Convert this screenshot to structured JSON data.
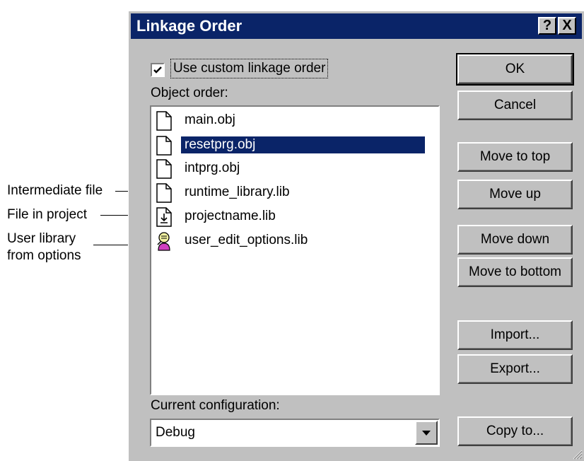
{
  "annotations": {
    "intermediate": "Intermediate file",
    "project": "File in project",
    "user_lib_1": "User library",
    "user_lib_2": "from options"
  },
  "dialog": {
    "title": "Linkage Order",
    "help_label": "?",
    "close_label": "X",
    "custom_order_label": "Use custom linkage order",
    "custom_order_checked": true,
    "object_order_label": "Object order:",
    "current_config_label": "Current configuration:",
    "current_config_value": "Debug"
  },
  "objects": [
    {
      "name": "main.obj",
      "icon": "file-icon"
    },
    {
      "name": "resetprg.obj",
      "icon": "file-icon",
      "selected": true
    },
    {
      "name": "intprg.obj",
      "icon": "file-icon"
    },
    {
      "name": "runtime_library.lib",
      "icon": "file-icon"
    },
    {
      "name": "projectname.lib",
      "icon": "project-file-icon"
    },
    {
      "name": "user_edit_options.lib",
      "icon": "user-library-icon"
    }
  ],
  "buttons": {
    "ok": "OK",
    "cancel": "Cancel",
    "move_top": "Move to top",
    "move_up": "Move up",
    "move_down": "Move down",
    "move_bottom": "Move to bottom",
    "import": "Import...",
    "export": "Export...",
    "copy_to": "Copy to..."
  },
  "colors": {
    "titlebar": "#0a2468",
    "selection": "#0a2468",
    "face": "#c0c0c0"
  }
}
